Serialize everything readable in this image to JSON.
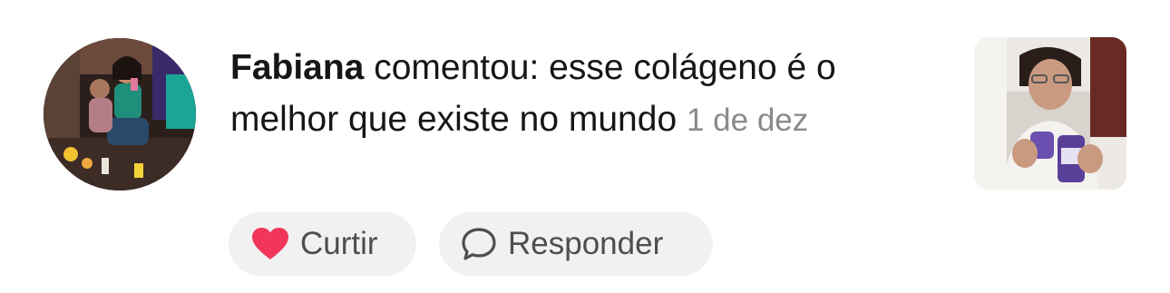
{
  "comment": {
    "author": "Fabiana",
    "text": " comentou: esse colágeno é o melhor que existe no mundo ",
    "timestamp": "1 de dez"
  },
  "actions": {
    "like_label": "Curtir",
    "reply_label": "Responder"
  },
  "icons": {
    "like": "heart-icon",
    "reply": "speech-bubble-icon"
  },
  "colors": {
    "heart": "#f1365a",
    "pill_background": "#f1f1f1",
    "timestamp": "#8a8a8a"
  }
}
